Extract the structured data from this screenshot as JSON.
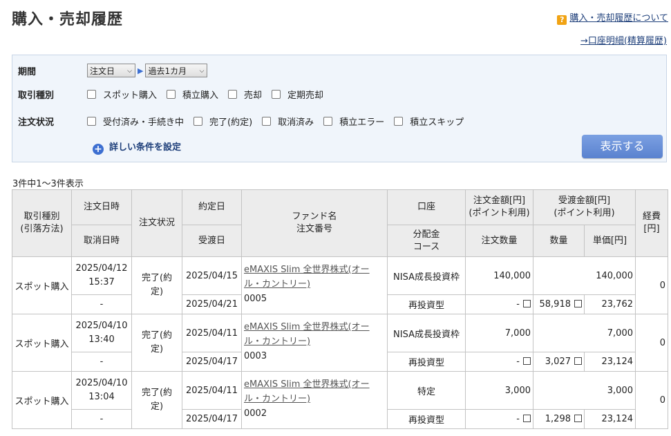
{
  "header": {
    "title": "購入・売却履歴",
    "help_label": "購入・売却履歴について",
    "account_link": "→口座明細(精算履歴)"
  },
  "filter": {
    "period_label": "期間",
    "period_select1": "注文日",
    "period_select2": "過去1カ月",
    "type_label": "取引種別",
    "type_options": [
      "スポット購入",
      "積立購入",
      "売却",
      "定期売却"
    ],
    "status_label": "注文状況",
    "status_options": [
      "受付済み・手続き中",
      "完了(約定)",
      "取消済み",
      "積立エラー",
      "積立スキップ"
    ],
    "more_conditions": "詳しい条件を設定",
    "show_button": "表示する"
  },
  "result_count": "3件中1〜3件表示",
  "table": {
    "headers": {
      "type": "取引種別\n(引落方法)",
      "order_date": "注文日時",
      "cancel_date": "取消日時",
      "status": "注文状況",
      "contract_date": "約定日",
      "delivery_date": "受渡日",
      "fund": "ファンド名\n注文番号",
      "account": "口座",
      "dividend": "分配金\nコース",
      "order_amount": "注文金額[円]\n(ポイント利用)",
      "order_qty": "注文数量",
      "receive_amount": "受渡金額[円]\n(ポイント利用)",
      "qty": "数量",
      "unit_price": "単価[円]",
      "fee": "経費\n[円]"
    },
    "rows": [
      {
        "type": "スポット購入",
        "order_date": "2025/04/12\n15:37",
        "cancel_date": "-",
        "status": "完了(約\n定)",
        "contract_date": "2025/04/15",
        "delivery_date": "2025/04/21",
        "fund_name": "eMAXIS Slim 全世界株式(オール・カントリー)",
        "order_no": "0005",
        "account": "NISA成長投資枠",
        "dividend": "再投資型",
        "order_amount": "140,000",
        "order_qty": "-",
        "receive_amount": "140,000",
        "qty": "58,918",
        "unit_price": "23,762",
        "fee": "0"
      },
      {
        "type": "スポット購入",
        "order_date": "2025/04/10\n13:40",
        "cancel_date": "-",
        "status": "完了(約\n定)",
        "contract_date": "2025/04/11",
        "delivery_date": "2025/04/17",
        "fund_name": "eMAXIS Slim 全世界株式(オール・カントリー)",
        "order_no": "0003",
        "account": "NISA成長投資枠",
        "dividend": "再投資型",
        "order_amount": "7,000",
        "order_qty": "-",
        "receive_amount": "7,000",
        "qty": "3,027",
        "unit_price": "23,124",
        "fee": "0"
      },
      {
        "type": "スポット購入",
        "order_date": "2025/04/10\n13:04",
        "cancel_date": "-",
        "status": "完了(約\n定)",
        "contract_date": "2025/04/11",
        "delivery_date": "2025/04/17",
        "fund_name": "eMAXIS Slim 全世界株式(オール・カントリー)",
        "order_no": "0002",
        "account": "特定",
        "dividend": "再投資型",
        "order_amount": "3,000",
        "order_qty": "-",
        "receive_amount": "3,000",
        "qty": "1,298",
        "unit_price": "23,124",
        "fee": "0"
      }
    ]
  },
  "colors": {
    "accent": "#3d6fd1",
    "button": "#6a90d9",
    "link": "#1e3f7a",
    "help_icon": "#f1a313"
  }
}
